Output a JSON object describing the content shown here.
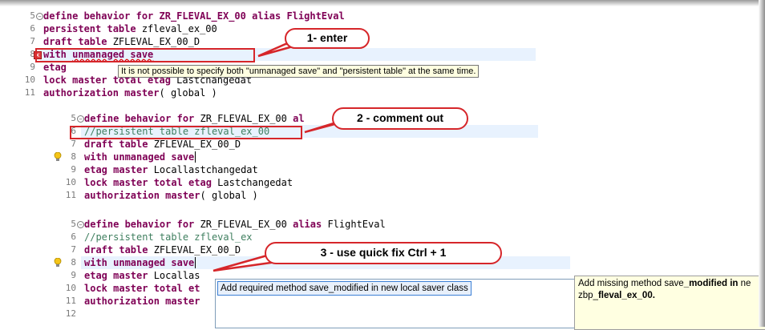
{
  "block1": {
    "lines": [
      {
        "num": "5",
        "fold": true,
        "tokens": [
          [
            "kw",
            "define behavior for "
          ],
          [
            "kw",
            "ZR_FLEVAL_EX_00 "
          ],
          [
            "kw",
            "alias "
          ],
          [
            "kw",
            "FlightEval"
          ]
        ]
      },
      {
        "num": "6",
        "tokens": [
          [
            "kw",
            "persistent table "
          ],
          [
            "plain",
            "zfleval_ex_00"
          ]
        ]
      },
      {
        "num": "7",
        "tokens": [
          [
            "kw",
            "draft table "
          ],
          [
            "plain",
            "ZFLEVAL_EX_00_D"
          ]
        ]
      },
      {
        "num": "8",
        "tokens": [
          [
            "kw",
            "with "
          ],
          [
            "kw",
            "unmanaged save"
          ]
        ],
        "error": true
      },
      {
        "num": "9",
        "tokens": [
          [
            "kw",
            "etag "
          ]
        ]
      },
      {
        "num": "10",
        "tokens": [
          [
            "kw",
            "lock master total etag "
          ],
          [
            "plain",
            "Lastchangedat"
          ]
        ]
      },
      {
        "num": "11",
        "tokens": [
          [
            "kw",
            "authorization master"
          ],
          [
            "plain",
            "( global )"
          ]
        ]
      }
    ],
    "tooltip": "It is not possible to specify both \"unmanaged save\" and \"persistent table\" at the same time."
  },
  "block2": {
    "lines": [
      {
        "num": "5",
        "fold": true,
        "tokens": [
          [
            "kw",
            "define behavior for "
          ],
          [
            "plain",
            "ZR_FLEVAL_EX_00 "
          ],
          [
            "kw",
            "al"
          ]
        ]
      },
      {
        "num": "6",
        "tokens": [
          [
            "cm",
            "//persistent table zfleval_ex_00"
          ]
        ]
      },
      {
        "num": "7",
        "tokens": [
          [
            "kw",
            "draft table "
          ],
          [
            "plain",
            "ZFLEVAL_EX_00_D"
          ]
        ]
      },
      {
        "num": "8",
        "tokens": [
          [
            "kw",
            "with unmanaged save"
          ]
        ],
        "bulb": true
      },
      {
        "num": "9",
        "tokens": [
          [
            "kw",
            "etag master "
          ],
          [
            "plain",
            "Locallastchangedat"
          ]
        ]
      },
      {
        "num": "10",
        "tokens": [
          [
            "kw",
            "lock master total etag "
          ],
          [
            "plain",
            "Lastchangedat"
          ]
        ]
      },
      {
        "num": "11",
        "tokens": [
          [
            "kw",
            "authorization master"
          ],
          [
            "plain",
            "( global )"
          ]
        ]
      }
    ]
  },
  "block3": {
    "lines": [
      {
        "num": "5",
        "fold": true,
        "tokens": [
          [
            "kw",
            "define behavior for "
          ],
          [
            "plain",
            "ZR_FLEVAL_EX_00 "
          ],
          [
            "kw",
            "alias "
          ],
          [
            "plain",
            "FlightEval"
          ]
        ]
      },
      {
        "num": "6",
        "tokens": [
          [
            "cm",
            "//persistent table zfleval_ex"
          ]
        ]
      },
      {
        "num": "7",
        "tokens": [
          [
            "kw",
            "draft table "
          ],
          [
            "plain",
            "ZFLEVAL_EX_00_D"
          ]
        ]
      },
      {
        "num": "8",
        "tokens": [
          [
            "kw",
            "with unmanaged save"
          ]
        ],
        "bulb": true
      },
      {
        "num": "9",
        "tokens": [
          [
            "kw",
            "etag master "
          ],
          [
            "plain",
            "Locallas"
          ]
        ]
      },
      {
        "num": "10",
        "tokens": [
          [
            "kw",
            "lock master total et"
          ]
        ]
      },
      {
        "num": "11",
        "tokens": [
          [
            "kw",
            "authorization master"
          ]
        ]
      },
      {
        "num": "12",
        "tokens": []
      }
    ],
    "quickfix_item": "Add required method save_modified in new local saver class",
    "info_prefix": "Add missing method save",
    "info_bold": "_modified in",
    "info_suffix": " ne",
    "info_line2": "zbp_",
    "info_line2_bold": "fleval_ex_00."
  },
  "callouts": {
    "step1": "1- enter",
    "step2": "2 - comment out",
    "step3": "3 - use quick fix Ctrl + 1"
  },
  "colors": {
    "keyword": "#7f0055",
    "comment": "#3f7f5f",
    "callout_border": "#d6262a",
    "current_line": "#e8f2fe",
    "tooltip_bg": "#ffffe1"
  }
}
